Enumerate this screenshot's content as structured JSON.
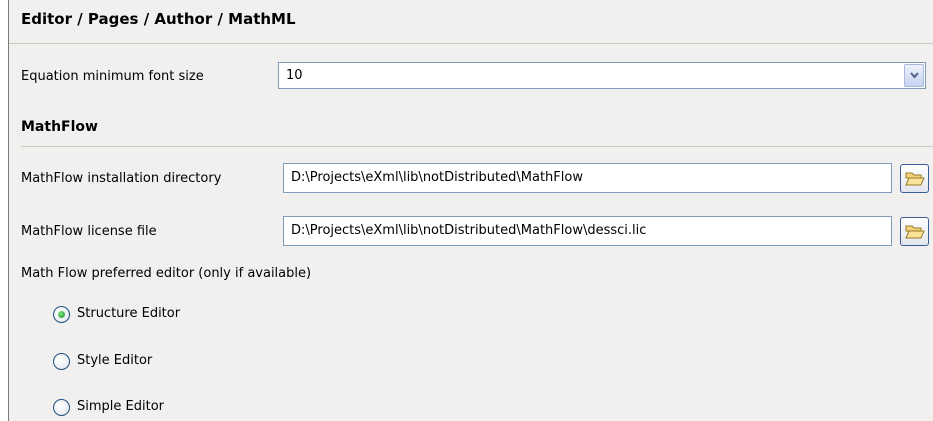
{
  "header": {
    "breadcrumb": "Editor / Pages / Author / MathML"
  },
  "equation_font": {
    "label": "Equation minimum font size",
    "value": "10"
  },
  "mathflow": {
    "section_title": "MathFlow",
    "install_dir": {
      "label": "MathFlow installation directory",
      "value": "D:\\Projects\\eXml\\lib\\notDistributed\\MathFlow"
    },
    "license_file": {
      "label": "MathFlow license file",
      "value": "D:\\Projects\\eXml\\lib\\notDistributed\\MathFlow\\dessci.lic"
    },
    "preferred_editor": {
      "label": "Math Flow preferred editor (only if available)",
      "options": [
        {
          "label": "Structure Editor",
          "selected": true
        },
        {
          "label": "Style Editor",
          "selected": false
        },
        {
          "label": "Simple Editor",
          "selected": false
        }
      ]
    }
  },
  "icons": {
    "dropdown": "chevron-down-icon",
    "browse": "folder-open-icon"
  },
  "colors": {
    "panel_bg": "#f1f0ee",
    "field_border": "#7f9db9",
    "radio_selected": "#1f8f2f"
  }
}
